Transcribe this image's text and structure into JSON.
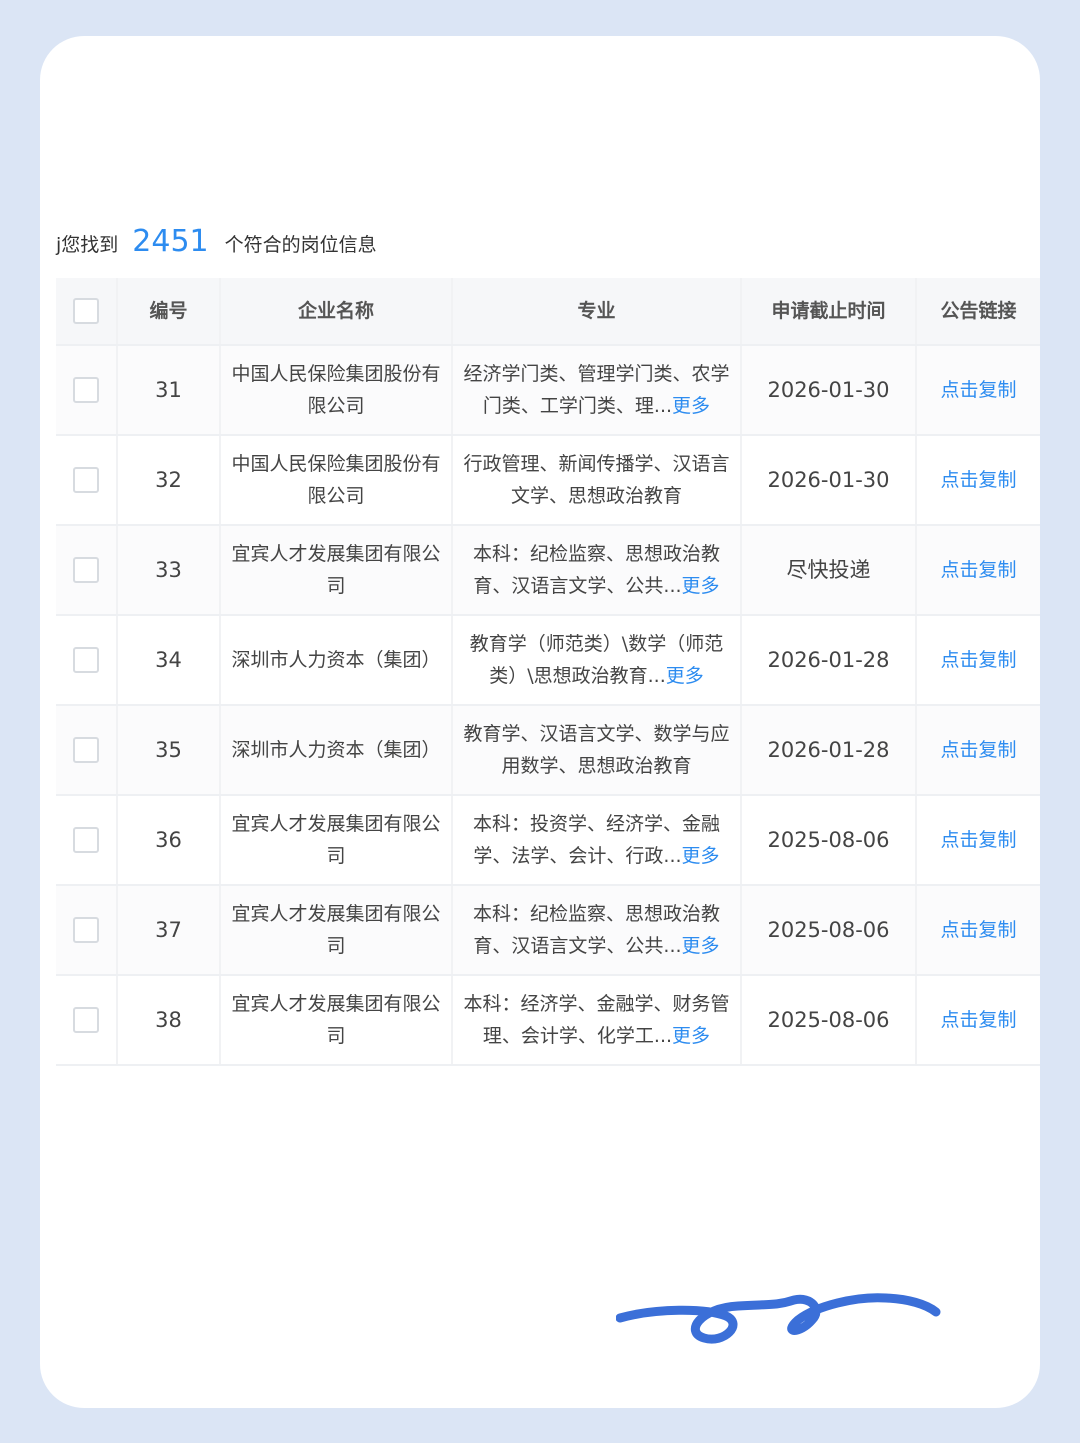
{
  "summary": {
    "prefix": "j您找到",
    "count": "2451",
    "suffix": "个符合的岗位信息"
  },
  "table": {
    "headers": [
      "编号",
      "企业名称",
      "专业",
      "申请截止时间",
      "公告链接"
    ],
    "rows": [
      {
        "num": "31",
        "name": "中国人民保险集团股份有限公司",
        "major": "经济学门类、管理学门类、农学门类、工学门类、理...",
        "more": "更多",
        "deadline": "2026-01-30",
        "link": "点击复制"
      },
      {
        "num": "32",
        "name": "中国人民保险集团股份有限公司",
        "major": "行政管理、新闻传播学、汉语言文学、思想政治教育",
        "more": "",
        "deadline": "2026-01-30",
        "link": "点击复制"
      },
      {
        "num": "33",
        "name": "宜宾人才发展集团有限公司",
        "major": "本科：纪检监察、思想政治教育、汉语言文学、公共...",
        "more": "更多",
        "deadline": "尽快投递",
        "link": "点击复制"
      },
      {
        "num": "34",
        "name": "深圳市人力资本（集团）",
        "major": "教育学（师范类）\\数学（师范类）\\思想政治教育...",
        "more": "更多",
        "deadline": "2026-01-28",
        "link": "点击复制"
      },
      {
        "num": "35",
        "name": "深圳市人力资本（集团）",
        "major": "教育学、汉语言文学、数学与应用数学、思想政治教育",
        "more": "",
        "deadline": "2026-01-28",
        "link": "点击复制"
      },
      {
        "num": "36",
        "name": "宜宾人才发展集团有限公司",
        "major": "本科：投资学、经济学、金融学、法学、会计、行政...",
        "more": "更多",
        "deadline": "2025-08-06",
        "link": "点击复制"
      },
      {
        "num": "37",
        "name": "宜宾人才发展集团有限公司",
        "major": "本科：纪检监察、思想政治教育、汉语言文学、公共...",
        "more": "更多",
        "deadline": "2025-08-06",
        "link": "点击复制"
      },
      {
        "num": "38",
        "name": "宜宾人才发展集团有限公司",
        "major": "本科：经济学、金融学、财务管理、会计学、化学工...",
        "more": "更多",
        "deadline": "2025-08-06",
        "link": "点击复制"
      }
    ]
  },
  "colors": {
    "background": "#dbe5f5",
    "accent": "#2d8cf0",
    "squiggle": "#3b6fd8"
  }
}
